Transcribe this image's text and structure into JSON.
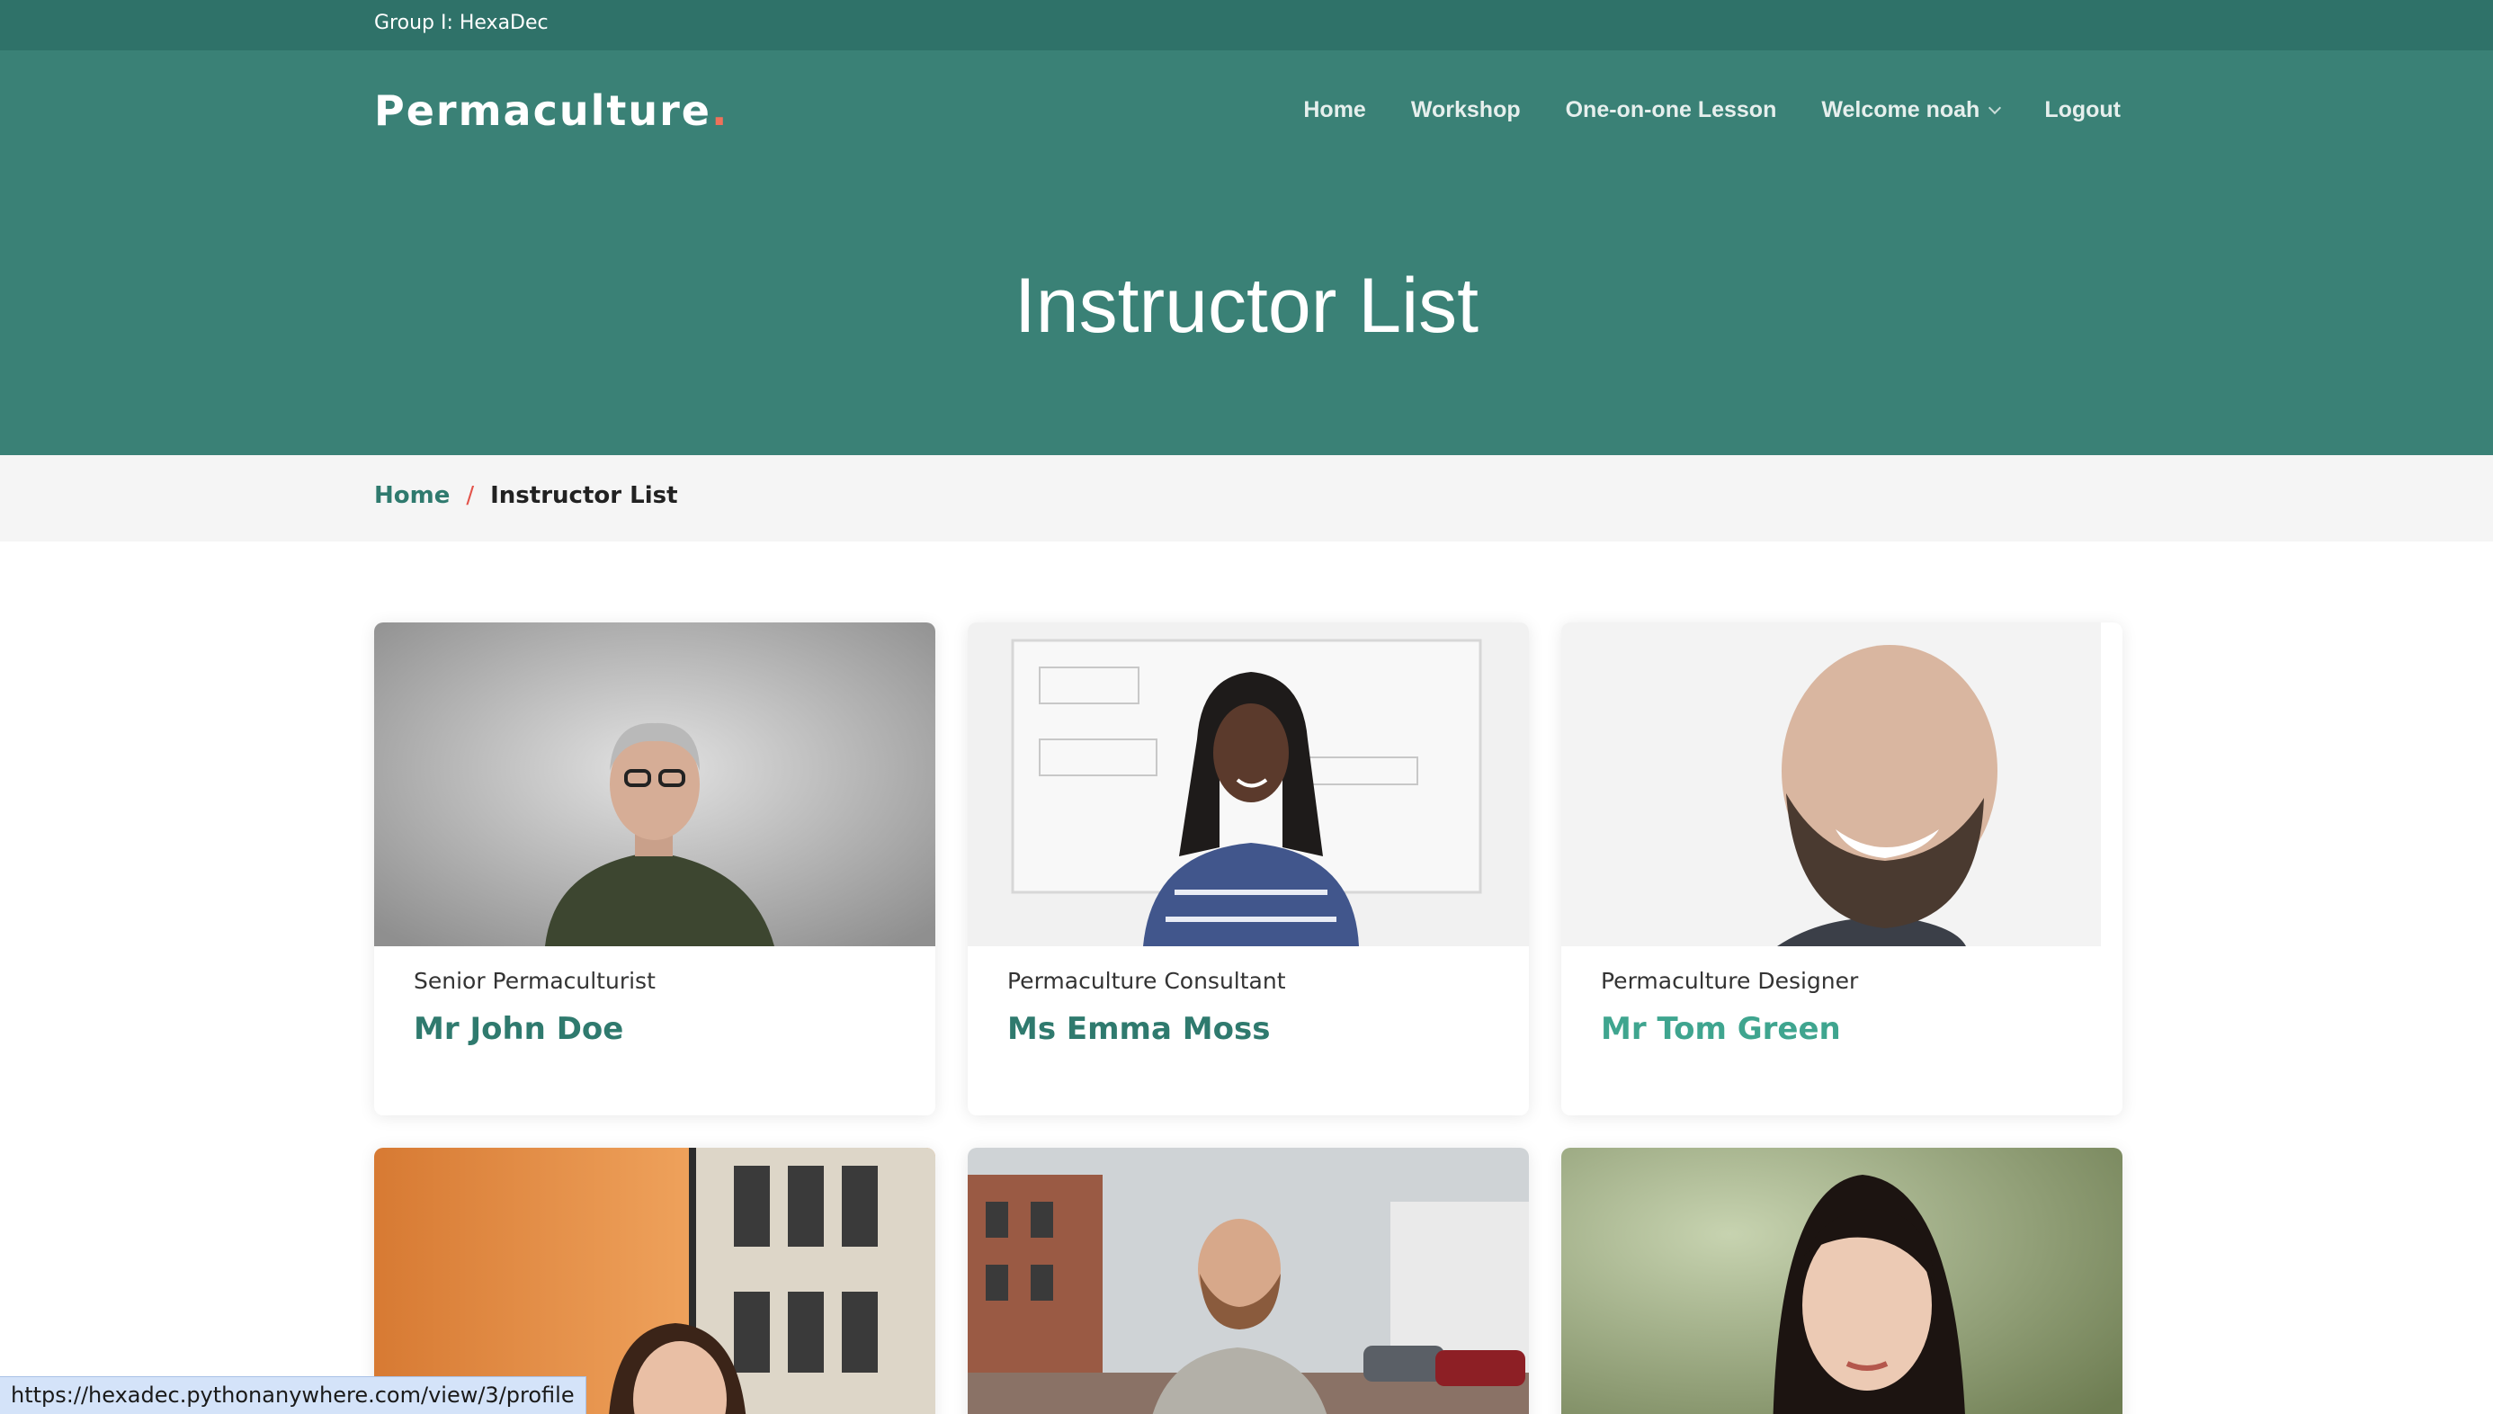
{
  "topbar": {
    "group_label": "Group I: HexaDec"
  },
  "brand": {
    "name": "Permaculture",
    "dot": "."
  },
  "nav": {
    "items": [
      "Home",
      "Workshop",
      "One-on-one Lesson",
      "Welcome noah",
      "Logout"
    ]
  },
  "hero": {
    "title": "Instructor List"
  },
  "breadcrumb": {
    "home": "Home",
    "separator": "/",
    "current": "Instructor List"
  },
  "instructors": [
    {
      "role": "Senior Permaculturist",
      "name": "Mr John Doe"
    },
    {
      "role": "Permaculture Consultant",
      "name": "Ms Emma Moss"
    },
    {
      "role": "Permaculture Designer",
      "name": "Mr Tom Green"
    },
    {
      "role": "",
      "name": ""
    },
    {
      "role": "",
      "name": ""
    },
    {
      "role": "",
      "name": ""
    }
  ],
  "status_bar": {
    "url": "https://hexadec.pythonanywhere.com/view/3/profile"
  },
  "colors": {
    "topbar": "#2f7269",
    "hero": "#3a8176",
    "accent": "#2f7a6e",
    "brand_dot": "#f0715a",
    "breadcrumb_bg": "#f5f5f5"
  }
}
